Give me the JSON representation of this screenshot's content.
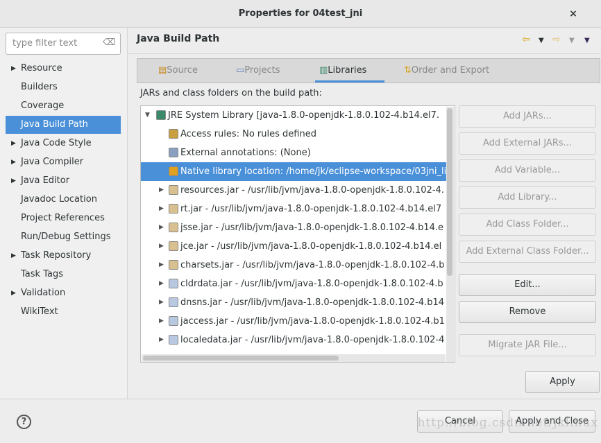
{
  "window": {
    "title": "Properties for 04test_jni",
    "close_icon": "×"
  },
  "filter": {
    "placeholder": "type filter text"
  },
  "sidebar": {
    "items": [
      {
        "label": "Resource",
        "expandable": true
      },
      {
        "label": "Builders",
        "expandable": false
      },
      {
        "label": "Coverage",
        "expandable": false
      },
      {
        "label": "Java Build Path",
        "expandable": false,
        "selected": true
      },
      {
        "label": "Java Code Style",
        "expandable": true
      },
      {
        "label": "Java Compiler",
        "expandable": true
      },
      {
        "label": "Java Editor",
        "expandable": true
      },
      {
        "label": "Javadoc Location",
        "expandable": false
      },
      {
        "label": "Project References",
        "expandable": false
      },
      {
        "label": "Run/Debug Settings",
        "expandable": false
      },
      {
        "label": "Task Repository",
        "expandable": true
      },
      {
        "label": "Task Tags",
        "expandable": false
      },
      {
        "label": "Validation",
        "expandable": true
      },
      {
        "label": "WikiText",
        "expandable": false
      }
    ]
  },
  "header": {
    "title": "Java Build Path"
  },
  "tabs": [
    {
      "label": "Source"
    },
    {
      "label": "Projects"
    },
    {
      "label": "Libraries",
      "selected": true
    },
    {
      "label": "Order and Export"
    }
  ],
  "main": {
    "label": "JARs and class folders on the build path:",
    "tree": [
      {
        "text": "JRE System Library [java-1.8.0-openjdk-1.8.0.102-4.b14.el7.",
        "level": 0,
        "state": "expanded",
        "icon": "library"
      },
      {
        "text": "Access rules: No rules defined",
        "level": 1,
        "state": "none",
        "icon": "access-rules"
      },
      {
        "text": "External annotations: (None)",
        "level": 1,
        "state": "none",
        "icon": "annotations"
      },
      {
        "text": "Native library location: /home/jk/eclipse-workspace/03jni_li",
        "level": 1,
        "state": "none",
        "icon": "native-library",
        "selected": true
      },
      {
        "text": "resources.jar - /usr/lib/jvm/java-1.8.0-openjdk-1.8.0.102-4.",
        "level": 1,
        "state": "collapsed",
        "icon": "jar"
      },
      {
        "text": "rt.jar - /usr/lib/jvm/java-1.8.0-openjdk-1.8.0.102-4.b14.el7",
        "level": 1,
        "state": "collapsed",
        "icon": "jar"
      },
      {
        "text": "jsse.jar - /usr/lib/jvm/java-1.8.0-openjdk-1.8.0.102-4.b14.e",
        "level": 1,
        "state": "collapsed",
        "icon": "jar"
      },
      {
        "text": "jce.jar - /usr/lib/jvm/java-1.8.0-openjdk-1.8.0.102-4.b14.el",
        "level": 1,
        "state": "collapsed",
        "icon": "jar"
      },
      {
        "text": "charsets.jar - /usr/lib/jvm/java-1.8.0-openjdk-1.8.0.102-4.b",
        "level": 1,
        "state": "collapsed",
        "icon": "jar"
      },
      {
        "text": "cldrdata.jar - /usr/lib/jvm/java-1.8.0-openjdk-1.8.0.102-4.b",
        "level": 1,
        "state": "collapsed",
        "icon": "ext-jar"
      },
      {
        "text": "dnsns.jar - /usr/lib/jvm/java-1.8.0-openjdk-1.8.0.102-4.b14",
        "level": 1,
        "state": "collapsed",
        "icon": "ext-jar"
      },
      {
        "text": "jaccess.jar - /usr/lib/jvm/java-1.8.0-openjdk-1.8.0.102-4.b1",
        "level": 1,
        "state": "collapsed",
        "icon": "ext-jar"
      },
      {
        "text": "localedata.jar - /usr/lib/jvm/java-1.8.0-openjdk-1.8.0.102-4",
        "level": 1,
        "state": "collapsed",
        "icon": "ext-jar"
      }
    ]
  },
  "buttons": [
    {
      "label": "Add JARs...",
      "enabled": false
    },
    {
      "label": "Add External JARs...",
      "enabled": false
    },
    {
      "label": "Add Variable...",
      "enabled": false
    },
    {
      "label": "Add Library...",
      "enabled": false
    },
    {
      "label": "Add Class Folder...",
      "enabled": false
    },
    {
      "label": "Add External Class Folder...",
      "enabled": false
    },
    {
      "label": "Edit...",
      "enabled": true
    },
    {
      "label": "Remove",
      "enabled": true
    },
    {
      "label": "Migrate JAR File...",
      "enabled": false
    }
  ],
  "footer": {
    "apply": "Apply",
    "cancel": "Cancel",
    "apply_close": "Apply and Close",
    "help_icon": "?"
  },
  "watermark": "http://blog.csdn.net/jklinux",
  "colors": {
    "selection": "#4a90d9"
  }
}
